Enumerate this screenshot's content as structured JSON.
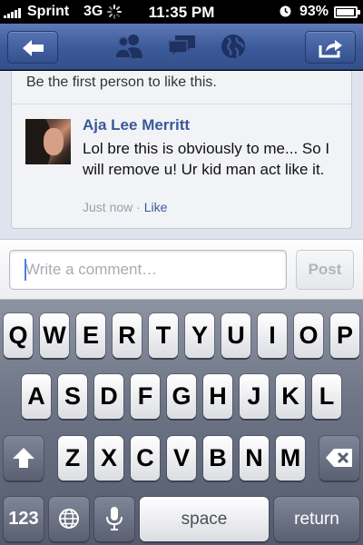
{
  "status_bar": {
    "carrier": "Sprint",
    "network": "3G",
    "time": "11:35 PM",
    "battery_percent": "93%",
    "battery_level": 0.93,
    "icons": [
      "signal-icon",
      "activity-spinner-icon",
      "alarm-clock-icon",
      "battery-icon"
    ]
  },
  "nav_bar": {
    "icons": [
      "back-arrow-icon",
      "friends-icon",
      "messages-icon",
      "globe-icon",
      "share-icon"
    ],
    "color": "#3b5998"
  },
  "post": {
    "likes_text": "Be the first person to like this.",
    "comment": {
      "author": "Aja Lee Merritt",
      "text": "Lol bre this is obviously to me... So I will remove u! Ur kid man act like it.",
      "time": "Just now",
      "separator": "·",
      "like_label": "Like"
    }
  },
  "composer": {
    "placeholder": "Write a comment…",
    "value": "",
    "post_label": "Post"
  },
  "keyboard": {
    "row1": [
      "Q",
      "W",
      "E",
      "R",
      "T",
      "Y",
      "U",
      "I",
      "O",
      "P"
    ],
    "row2": [
      "A",
      "S",
      "D",
      "F",
      "G",
      "H",
      "J",
      "K",
      "L"
    ],
    "row3": [
      "Z",
      "X",
      "C",
      "V",
      "B",
      "N",
      "M"
    ],
    "numbers_label": "123",
    "space_label": "space",
    "return_label": "return",
    "icons": [
      "shift-icon",
      "delete-icon",
      "globe-icon",
      "microphone-icon"
    ]
  }
}
